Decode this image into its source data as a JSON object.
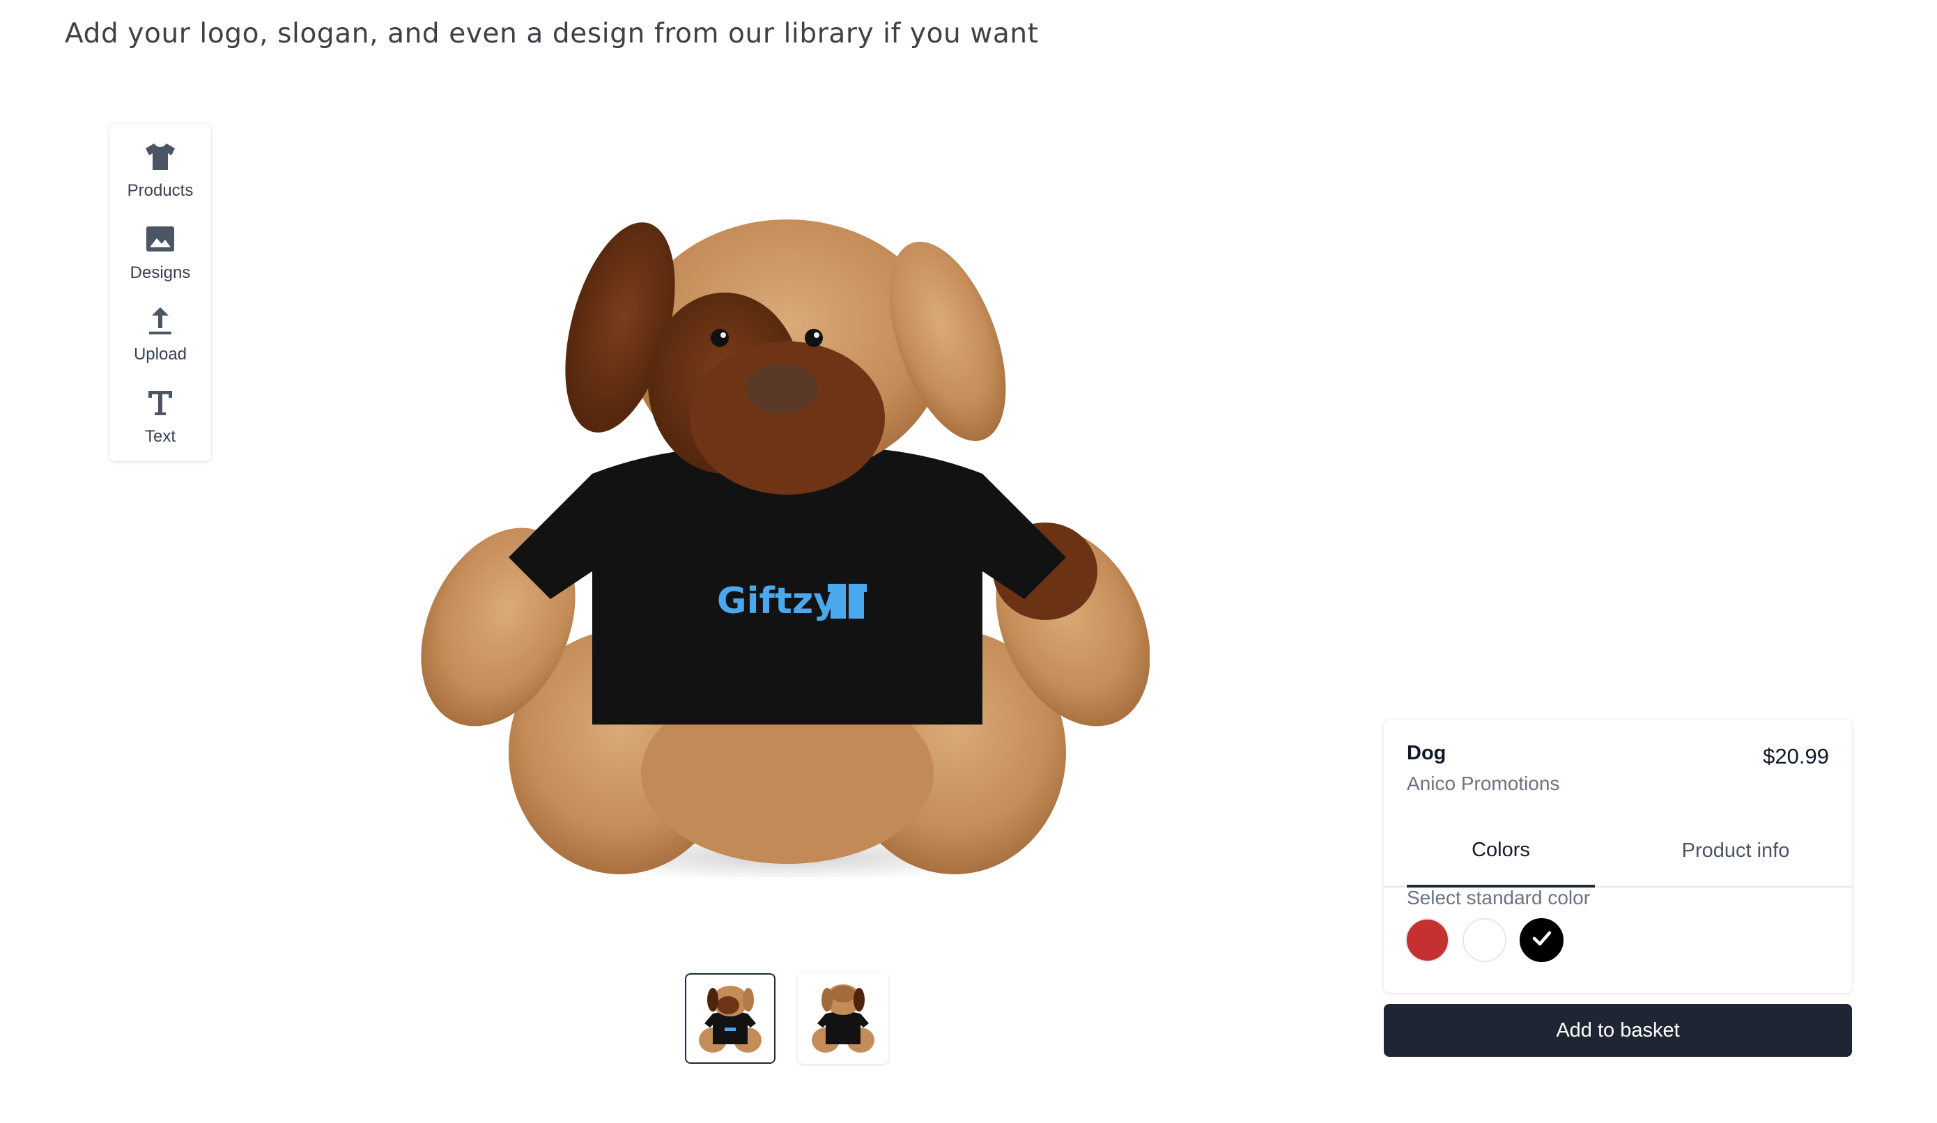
{
  "header": {
    "headline": "Add your logo, slogan, and even a design from our library if you want"
  },
  "toolbar": {
    "items": [
      {
        "label": "Products",
        "icon": "tshirt-icon"
      },
      {
        "label": "Designs",
        "icon": "image-icon"
      },
      {
        "label": "Upload",
        "icon": "upload-icon"
      },
      {
        "label": "Text",
        "icon": "text-icon"
      }
    ]
  },
  "preview": {
    "shirt_logo_text": "Giftzy",
    "thumbnails": [
      "thumbnail-front",
      "thumbnail-back"
    ],
    "selected_thumbnail": 0
  },
  "product": {
    "name": "Dog",
    "brand": "Anico Promotions",
    "price": "$20.99",
    "tabs": [
      "Colors",
      "Product info"
    ],
    "active_tab": "Colors",
    "swatch_label": "Select standard color",
    "colors": [
      {
        "name": "red",
        "hex": "#c53030"
      },
      {
        "name": "white",
        "hex": "#ffffff"
      },
      {
        "name": "black",
        "hex": "#000000",
        "selected": true
      }
    ]
  },
  "actions": {
    "add_to_basket": "Add to basket"
  },
  "theme": {
    "primary_button": "#1f2633",
    "logo_blue": "#4aa8ee"
  }
}
